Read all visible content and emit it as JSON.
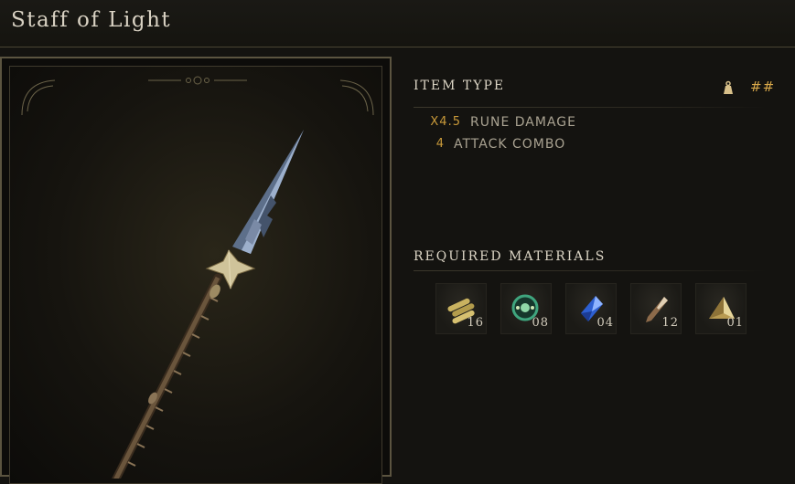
{
  "item": {
    "name": "Staff of Light"
  },
  "item_type": {
    "heading": "ITEM TYPE",
    "weight_value": "##"
  },
  "stats": [
    {
      "value": "X4.5",
      "label": "RUNE DAMAGE"
    },
    {
      "value": "4",
      "label": "ATTACK COMBO"
    }
  ],
  "materials": {
    "heading": "REQUIRED MATERIALS",
    "items": [
      {
        "icon": "wood-bundle-icon",
        "count": "16"
      },
      {
        "icon": "green-orb-icon",
        "count": "08"
      },
      {
        "icon": "blue-crystal-icon",
        "count": "04"
      },
      {
        "icon": "bone-shard-icon",
        "count": "12"
      },
      {
        "icon": "gold-fragment-icon",
        "count": "01"
      }
    ]
  },
  "colors": {
    "accent_gold": "#c99a3a",
    "frame_border": "#5b5440",
    "background": "#141310"
  }
}
